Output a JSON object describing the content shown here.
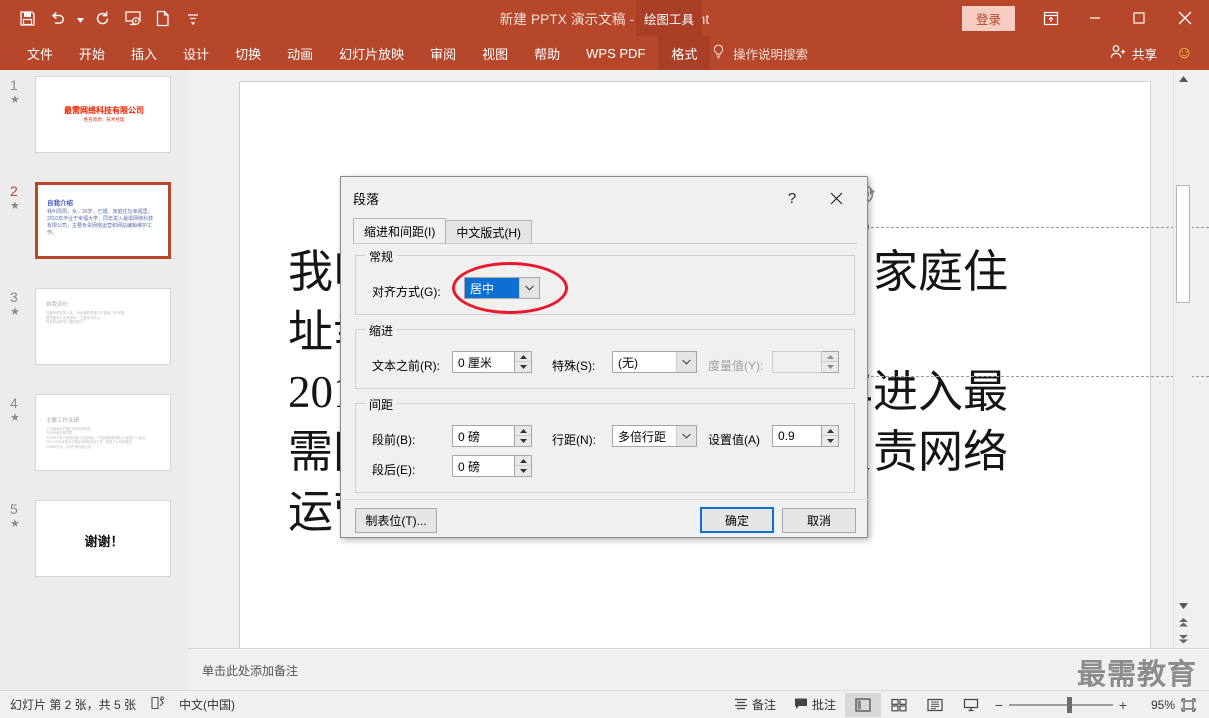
{
  "titlebar": {
    "document_title": "新建 PPTX 演示文稿  -  PowerPoint",
    "context_tab_group": "绘图工具",
    "signin_label": "登录",
    "quick_access": [
      {
        "name": "save-icon",
        "label": "保存"
      },
      {
        "name": "undo-icon",
        "label": "撤销"
      },
      {
        "name": "redo-icon",
        "label": "恢复"
      },
      {
        "name": "start-slideshow-icon",
        "label": "从头开始"
      },
      {
        "name": "new-file-icon",
        "label": "新建"
      },
      {
        "name": "customize-qat-icon",
        "label": "自定义快速访问工具栏"
      }
    ],
    "window_controls": {
      "ribbon_display": "▣",
      "minimize": "—",
      "maximize": "▢",
      "close": "✕"
    }
  },
  "ribbon": {
    "tabs": [
      {
        "label": "文件",
        "active": false
      },
      {
        "label": "开始",
        "active": false
      },
      {
        "label": "插入",
        "active": false
      },
      {
        "label": "设计",
        "active": false
      },
      {
        "label": "切换",
        "active": false
      },
      {
        "label": "动画",
        "active": false
      },
      {
        "label": "幻灯片放映",
        "active": false
      },
      {
        "label": "审阅",
        "active": false
      },
      {
        "label": "视图",
        "active": false
      },
      {
        "label": "帮助",
        "active": false
      },
      {
        "label": "WPS PDF",
        "active": false
      },
      {
        "label": "格式",
        "active": true
      }
    ],
    "tell_me": "操作说明搜索",
    "share_label": "共享"
  },
  "thumbnails": [
    {
      "number": "1",
      "title": "最需网络科技有限公司",
      "subtitle": "姓名周周：技术经理",
      "body": "",
      "selected": false
    },
    {
      "number": "2",
      "title": "自我介绍",
      "body": "我叫周周，女，30岁，已婚，家庭住址幸福里。\n2010年毕业于幸福大学，同年进入最需网络科技有限公司，主要负责网络运营和网站编辑维护工作。",
      "selected": true
    },
    {
      "number": "3",
      "title": "自我评价",
      "body": "性格有耐性的人生，对长期的思维方式善用工作年限。\n善思善学与业条基本，主要变化中心。\n具有较为的学习整形能力",
      "selected": false
    },
    {
      "number": "4",
      "title": "主要工作业绩",
      "body": "工作期间过于理念本网站的维护。\n2010年承办登录表。\n2012年少有于新的传播了红色地区，产品的推荐帮助公众渠道个人接引。\n2013-2016年各负责网络运营规划及工作，带领了公司的服务。\n2018年至今，负责产管系统业绩。",
      "selected": false
    },
    {
      "number": "5",
      "title": "谢谢！",
      "body": "",
      "selected": false
    }
  ],
  "slide": {
    "text": "我叫周周，女，30岁，已婚，家庭住址幸福里。2010年毕业于幸福大学，同年进入最需网络科技有限公司，主要负责网络运营和网站编辑维护工作。",
    "lines": [
      "我叫周周，女，30岁，已婚，家庭住",
      "址幸福里。",
      "2010年毕业于幸福大学，同年进入最",
      "需网络科技有限公司，主要负责网络",
      "运营和网站编辑维护工作。"
    ]
  },
  "notes": {
    "placeholder": "单击此处添加备注",
    "watermark": "最需教育"
  },
  "statusbar": {
    "slide_info": "幻灯片 第 2 张，共 5 张",
    "language": "中文(中国)",
    "notes_label": "备注",
    "comments_label": "批注",
    "zoom_level": "95%",
    "views": [
      {
        "name": "normal-view-button",
        "active": true
      },
      {
        "name": "slide-sorter-view-button",
        "active": false
      },
      {
        "name": "reading-view-button",
        "active": false
      },
      {
        "name": "slideshow-view-button",
        "active": false
      }
    ]
  },
  "dialog": {
    "title": "段落",
    "tabs": [
      {
        "label": "缩进和间距(I)",
        "accel": "I",
        "active": true
      },
      {
        "label": "中文版式(H)",
        "accel": "H",
        "active": false
      }
    ],
    "general": {
      "group_label": "常规",
      "alignment_label": "对齐方式(G):",
      "alignment_value": "居中"
    },
    "indent": {
      "group_label": "缩进",
      "before_text_label": "文本之前(R):",
      "before_text_value": "0 厘米",
      "special_label": "特殊(S):",
      "special_value": "(无)",
      "measure_label": "度量值(Y):",
      "measure_value": ""
    },
    "spacing": {
      "group_label": "间距",
      "before_label": "段前(B):",
      "before_value": "0 磅",
      "after_label": "段后(E):",
      "after_value": "0 磅",
      "line_spacing_label": "行距(N):",
      "line_spacing_value": "多倍行距",
      "set_value_label": "设置值(A)",
      "set_value": "0.9"
    },
    "buttons": {
      "tabs_button": "制表位(T)...",
      "ok": "确定",
      "cancel": "取消",
      "help": "?",
      "close": "✕"
    }
  },
  "colors": {
    "brand": "#b7472a",
    "context_tab": "#a93f26",
    "selection_blue": "#0b70d1",
    "annotation_red": "#e8192c",
    "thumb_title_blue": "#3f5fbf",
    "slide1_title_red": "#ee2200"
  }
}
